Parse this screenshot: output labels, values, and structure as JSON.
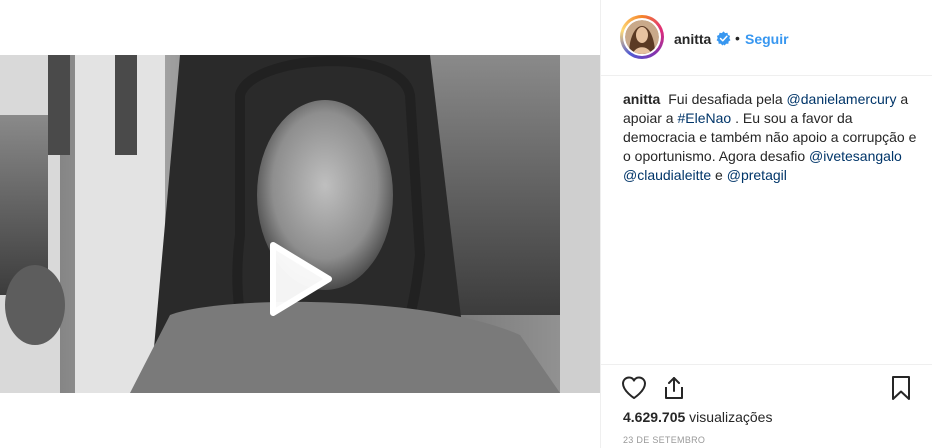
{
  "post": {
    "author": "anitta",
    "follow_label": "Seguir",
    "separator": "•",
    "caption": {
      "user": "anitta",
      "t1": " Fui desafiada pela ",
      "m1": "@danielamercury",
      "t2": " a apoiar a ",
      "h1": "#EleNao",
      "t3": " . Eu sou a favor da democracia e também não apoio a corrupção e o oportunismo. Agora desafio ",
      "m2": "@ivetesangalo",
      "t4": " ",
      "m3": "@claudialeitte",
      "t5": " e ",
      "m4": "@pretagil"
    },
    "views_count": "4.629.705",
    "views_label": " visualizações",
    "date": "23 de setembro"
  },
  "icons": {
    "play": "play-icon",
    "verified": "verified-badge-icon",
    "like": "heart-icon",
    "share": "share-icon",
    "save": "bookmark-icon"
  },
  "colors": {
    "accent": "#3897f0",
    "link": "#003569",
    "verified": "#3897f0",
    "muted": "#999999"
  }
}
